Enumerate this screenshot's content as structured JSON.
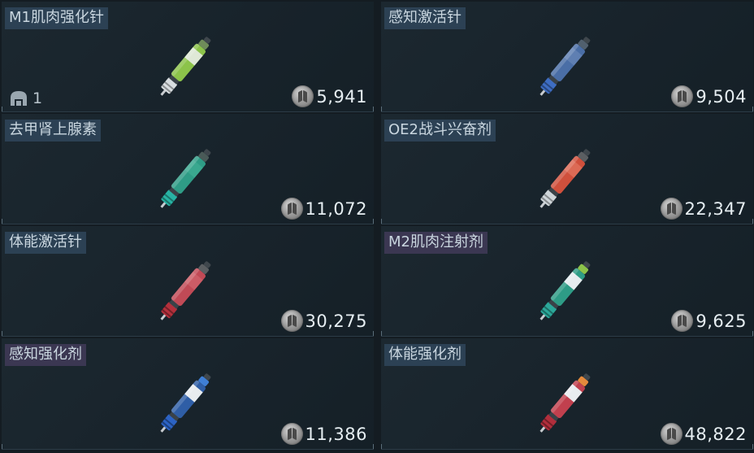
{
  "items": [
    {
      "name": "M1肌肉强化针",
      "price": "5,941",
      "stack": "1",
      "title_style": "blue",
      "colors": {
        "body": "#8cc34a",
        "band": "#dfe8d6",
        "tip": "#d8dde0",
        "cap": "#6f8c5a"
      },
      "icon": "syringe-icon"
    },
    {
      "name": "感知激活针",
      "price": "9,504",
      "stack": "",
      "title_style": "blue",
      "colors": {
        "body": "#4a6ea6",
        "band": "#5f7fb2",
        "tip": "#3e6dc2",
        "cap": "#51606e"
      },
      "icon": "syringe-icon"
    },
    {
      "name": "去甲肾上腺素",
      "price": "11,072",
      "stack": "",
      "title_style": "blue",
      "colors": {
        "body": "#2f9c86",
        "band": "#3aa88f",
        "tip": "#28b3a4",
        "cap": "#4a5a58"
      },
      "icon": "syringe-icon"
    },
    {
      "name": "OE2战斗兴奋剂",
      "price": "22,347",
      "stack": "",
      "title_style": "blue",
      "colors": {
        "body": "#d0503c",
        "band": "#dc6a55",
        "tip": "#cfd6da",
        "cap": "#5b5f62"
      },
      "icon": "syringe-icon"
    },
    {
      "name": "体能激活针",
      "price": "30,275",
      "stack": "",
      "title_style": "blue",
      "colors": {
        "body": "#c14a56",
        "band": "#cc5c66",
        "tip": "#b3303c",
        "cap": "#5b5f62"
      },
      "icon": "syringe-icon"
    },
    {
      "name": "M2肌肉注射剂",
      "price": "9,625",
      "stack": "",
      "title_style": "purple",
      "colors": {
        "body": "#2e9c86",
        "band": "#e6ecef",
        "tip": "#2ca89a",
        "cap": "#8cc34a"
      },
      "icon": "syringe-icon"
    },
    {
      "name": "感知强化剂",
      "price": "11,386",
      "stack": "",
      "title_style": "purple",
      "colors": {
        "body": "#2f5ea6",
        "band": "#e8ecef",
        "tip": "#2c63c4",
        "cap": "#3f7fd6"
      },
      "icon": "syringe-icon"
    },
    {
      "name": "体能强化剂",
      "price": "48,822",
      "stack": "",
      "title_style": "blue",
      "colors": {
        "body": "#c1404e",
        "band": "#e8ecef",
        "tip": "#b12e3c",
        "cap": "#e58a3c"
      },
      "icon": "syringe-icon"
    }
  ]
}
